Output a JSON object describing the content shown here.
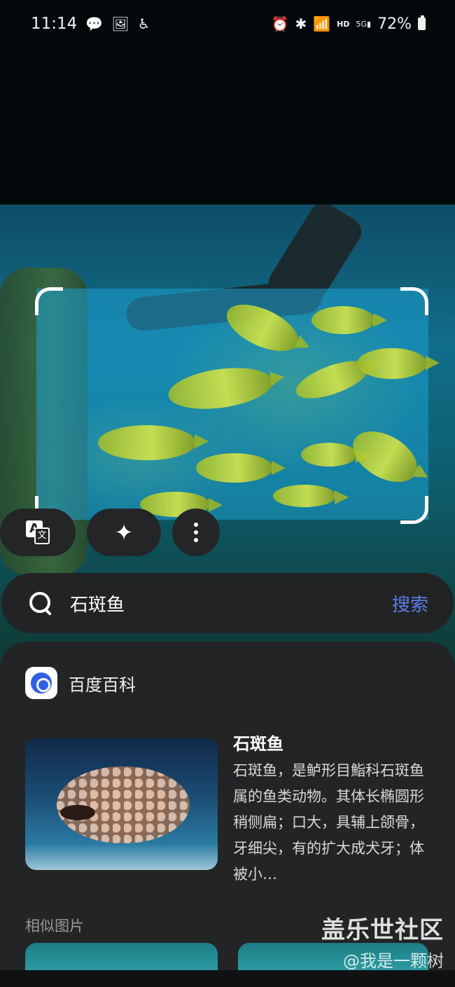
{
  "status_bar": {
    "time": "11:14",
    "left_icons": [
      "wechat-icon",
      "gallery-icon",
      "accessibility-icon"
    ],
    "right_icons": [
      "alarm-icon",
      "bluetooth-icon",
      "wifi-icon",
      "hd-icon",
      "5g-signal-icon",
      "battery-icon"
    ],
    "hd": "HD",
    "network": "5G",
    "battery": "72%"
  },
  "actions": {
    "translate_a": "A",
    "translate_b": "文",
    "ai_icon": "sparkle-icon",
    "more_icon": "more-vertical-icon"
  },
  "search": {
    "query": "石斑鱼",
    "submit_label": "搜索"
  },
  "result": {
    "source_name": "百度百科",
    "title": "石斑鱼",
    "description": "石斑鱼，是鲈形目鮨科石斑鱼属的鱼类动物。其体长椭圆形稍侧扁；口大，具辅上颌骨，牙细尖，有的扩大成犬牙；体被小…"
  },
  "similar": {
    "label": "相似图片"
  },
  "watermark": {
    "line1": "盖乐世社区",
    "line2": "@我是一颗树"
  },
  "colors": {
    "accent": "#5b7fe8",
    "card": "#222426",
    "pill": "#232527"
  }
}
